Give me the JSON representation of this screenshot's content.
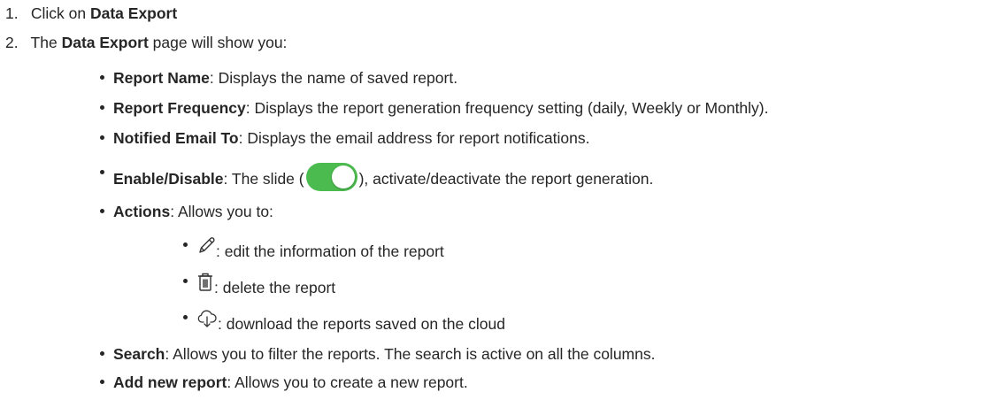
{
  "steps": [
    {
      "number": "1.",
      "prefix": "Click on ",
      "bold": "Data Export",
      "suffix": ""
    },
    {
      "number": "2.",
      "prefix": "The ",
      "bold": "Data Export",
      "suffix": " page will show you:"
    }
  ],
  "bullets": {
    "report_name": {
      "label": "Report Name",
      "text": ": Displays the name of saved report."
    },
    "report_frequency": {
      "label": "Report Frequency",
      "text": ": Displays the report generation frequency setting (daily, Weekly or Monthly)."
    },
    "notified_email": {
      "label": "Notified Email To",
      "text": ": Displays the email address for report notifications."
    },
    "enable_disable": {
      "label": "Enable/Disable",
      "text_before": ": The slide (",
      "text_after": "), activate/deactivate the report generation.",
      "toggle_color": "#4cbb4f",
      "toggle_state": "on"
    },
    "actions": {
      "label": "Actions",
      "text": ": Allows you to:",
      "sub_items": [
        {
          "icon": "pencil-icon",
          "text": ": edit the information of the report"
        },
        {
          "icon": "trash-icon",
          "text": ": delete the report"
        },
        {
          "icon": "cloud-download-icon",
          "text": ": download the reports saved on the cloud"
        }
      ]
    },
    "search": {
      "label": "Search",
      "text": ": Allows you to filter the reports. The search is active on all the columns."
    },
    "add_new_report": {
      "label": "Add new report",
      "text": ": Allows you to create a new report."
    }
  }
}
